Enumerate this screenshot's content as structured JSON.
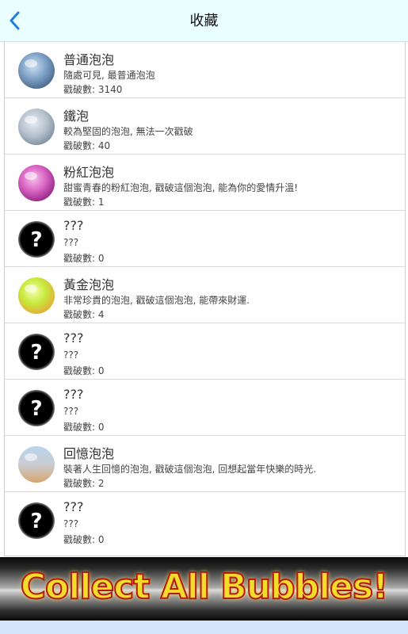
{
  "header": {
    "title": "收藏"
  },
  "bubbles": [
    {
      "name": "普通泡泡",
      "desc": "隨處可見, 最普通泡泡",
      "count": "戳破數: 3140",
      "icon": "blue-bubble-icon"
    },
    {
      "name": "鐵泡",
      "desc": "較為堅固的泡泡, 無法一次戳破",
      "count": "戳破數: 40",
      "icon": "iron-bubble-icon"
    },
    {
      "name": "粉紅泡泡",
      "desc": "甜蜜青春的粉紅泡泡, 戳破這個泡泡, 能為你的愛情升溫!",
      "count": "戳破數: 1",
      "icon": "pink-bubble-icon"
    },
    {
      "name": "???",
      "desc": "???",
      "count": "戳破數: 0",
      "icon": "unknown-bubble-icon"
    },
    {
      "name": "黃金泡泡",
      "desc": "非常珍貴的泡泡, 戳破這個泡泡, 能帶來財運.",
      "count": "戳破數: 4",
      "icon": "golden-bubble-icon"
    },
    {
      "name": "???",
      "desc": "???",
      "count": "戳破數: 0",
      "icon": "unknown-bubble-icon"
    },
    {
      "name": "???",
      "desc": "???",
      "count": "戳破數: 0",
      "icon": "unknown-bubble-icon"
    },
    {
      "name": "回憶泡泡",
      "desc": "裝著人生回憶的泡泡, 戳破這個泡泡, 回想起當年快樂的時光.",
      "count": "戳破數: 2",
      "icon": "memory-bubble-icon"
    },
    {
      "name": "???",
      "desc": "???",
      "count": "戳破數: 0",
      "icon": "unknown-bubble-icon"
    }
  ],
  "unknown_glyph": "?",
  "banner": {
    "text": "Collect All Bubbles!"
  },
  "colors": {
    "header_bg": "#eaffff",
    "back_arrow": "#1e7fe0",
    "banner_text": "#f3dd2a",
    "banner_outline": "#b31a12"
  }
}
